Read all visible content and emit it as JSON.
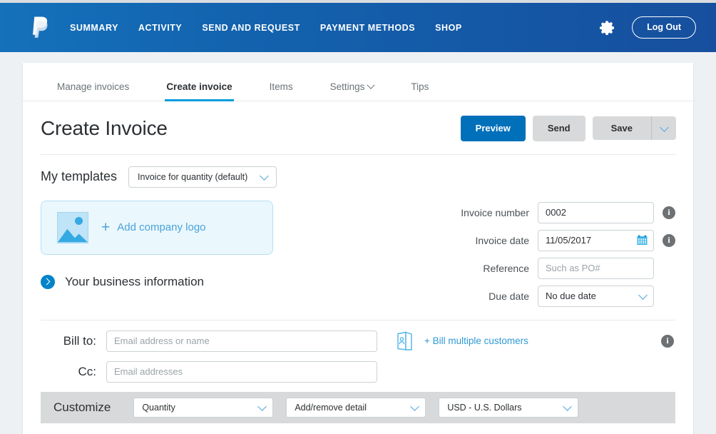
{
  "header": {
    "logo_name": "paypal-logo",
    "nav": [
      {
        "label": "SUMMARY"
      },
      {
        "label": "ACTIVITY"
      },
      {
        "label": "SEND AND REQUEST"
      },
      {
        "label": "PAYMENT METHODS"
      },
      {
        "label": "SHOP"
      }
    ],
    "gear_icon": "gear-icon",
    "logout_label": "Log Out",
    "gradient_start": "#1571ba",
    "gradient_end": "#164f9e"
  },
  "tabs": [
    {
      "label": "Manage invoices",
      "active": false,
      "caret": false
    },
    {
      "label": "Create invoice",
      "active": true,
      "caret": false
    },
    {
      "label": "Items",
      "active": false,
      "caret": false
    },
    {
      "label": "Settings",
      "active": false,
      "caret": true
    },
    {
      "label": "Tips",
      "active": false,
      "caret": false
    }
  ],
  "page": {
    "title": "Create Invoice",
    "accent_color": "#009cde",
    "primary_button_color": "#0070ba"
  },
  "actions": {
    "preview_label": "Preview",
    "send_label": "Send",
    "save_label": "Save",
    "save_caret_icon": "chevron-down-icon"
  },
  "templates": {
    "label": "My templates",
    "selected": "Invoice for quantity (default)"
  },
  "logo_upload": {
    "icon": "image-placeholder-icon",
    "plus": "+",
    "label": "Add company logo"
  },
  "business_info": {
    "icon": "chevron-right-circle-icon",
    "label": "Your business information"
  },
  "invoice_fields": [
    {
      "label": "Invoice number",
      "value": "0002",
      "placeholder": "",
      "type": "text",
      "info": true,
      "calendar": false
    },
    {
      "label": "Invoice date",
      "value": "11/05/2017",
      "placeholder": "",
      "type": "date",
      "info": true,
      "calendar": true
    },
    {
      "label": "Reference",
      "value": "",
      "placeholder": "Such as PO#",
      "type": "text",
      "info": false,
      "calendar": false
    },
    {
      "label": "Due date",
      "value": "No due date",
      "placeholder": "",
      "type": "select",
      "info": false,
      "calendar": false
    }
  ],
  "bill_to": {
    "label": "Bill to:",
    "placeholder": "Email address or name",
    "value": "",
    "contact_icon": "address-book-icon",
    "multi_link": "+ Bill multiple customers",
    "link_color": "#2f9ad4",
    "info": true
  },
  "cc": {
    "label": "Cc:",
    "placeholder": "Email addresses",
    "value": ""
  },
  "customize": {
    "label": "Customize",
    "selects": [
      {
        "value": "Quantity"
      },
      {
        "value": "Add/remove detail"
      },
      {
        "value": "USD - U.S. Dollars"
      }
    ]
  }
}
